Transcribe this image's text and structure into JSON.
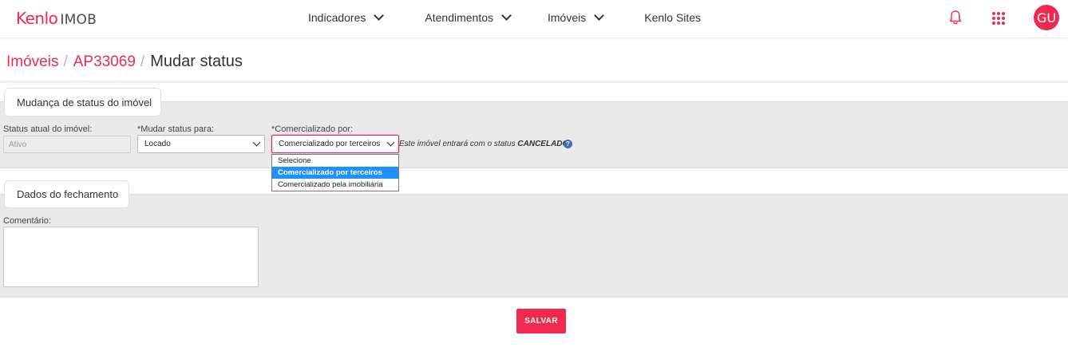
{
  "brand": {
    "name": "Kenlo",
    "product": "IMOB"
  },
  "nav": {
    "items": [
      {
        "label": "Indicadores",
        "has_dropdown": true
      },
      {
        "label": "Atendimentos",
        "has_dropdown": true
      },
      {
        "label": "Imóveis",
        "has_dropdown": true
      },
      {
        "label": "Kenlo Sites",
        "has_dropdown": false
      }
    ],
    "icons": [
      "bell-icon",
      "apps-grid-icon"
    ],
    "avatar_initials": "GU"
  },
  "breadcrumb": {
    "items": [
      "Imóveis",
      "AP33069"
    ],
    "separator": "/",
    "current": "Mudar status"
  },
  "status_section": {
    "title": "Mudança de status do imóvel",
    "current_status": {
      "label": "Status atual do imóvel:",
      "value": "Ativo"
    },
    "new_status": {
      "label": "*Mudar status para:",
      "value": "Locado"
    },
    "commercialized_by": {
      "label": "*Comercializado por:",
      "value": "Comercializado por terceiros",
      "options": [
        "Selecione",
        "Comercializado por terceiros",
        "Comercializado pela imobiliária"
      ],
      "selected_index": 1
    },
    "info_prefix": "Este imóvel entrará com o status",
    "info_status": "CANCELADO",
    "help_glyph": "?"
  },
  "closing_section": {
    "title": "Dados do fechamento",
    "comment_label": "Comentário:",
    "comment_value": ""
  },
  "actions": {
    "save_label": "SALVAR"
  },
  "colors": {
    "accent": "#f2294e",
    "panel": "#e9e9e9",
    "selected_option": "#1e90ff"
  }
}
